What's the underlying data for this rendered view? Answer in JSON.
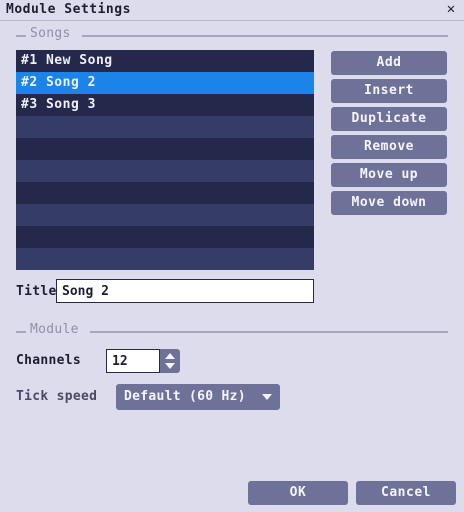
{
  "window": {
    "title": "Module Settings",
    "close_icon": "close-icon"
  },
  "songs_section": {
    "label": "Songs",
    "list": [
      {
        "label": "#1 New Song",
        "selected": false
      },
      {
        "label": "#2 Song 2",
        "selected": true
      },
      {
        "label": "#3 Song 3",
        "selected": false
      },
      {
        "label": "",
        "selected": false
      },
      {
        "label": "",
        "selected": false
      },
      {
        "label": "",
        "selected": false
      },
      {
        "label": "",
        "selected": false
      },
      {
        "label": "",
        "selected": false
      },
      {
        "label": "",
        "selected": false
      },
      {
        "label": "",
        "selected": false
      }
    ],
    "buttons": {
      "add": "Add",
      "insert": "Insert",
      "duplicate": "Duplicate",
      "remove": "Remove",
      "move_up": "Move up",
      "move_down": "Move down"
    },
    "title_label": "Title",
    "title_value": "Song 2"
  },
  "module_section": {
    "label": "Module",
    "channels_label": "Channels",
    "channels_value": "12",
    "tick_speed_label": "Tick speed",
    "tick_speed_value": "Default (60 Hz)"
  },
  "footer": {
    "ok": "OK",
    "cancel": "Cancel"
  },
  "colors": {
    "background": "#dcdcec",
    "list_dark": "#24284a",
    "list_light": "#353c66",
    "selection": "#1a84e8",
    "button": "#6e7299"
  }
}
